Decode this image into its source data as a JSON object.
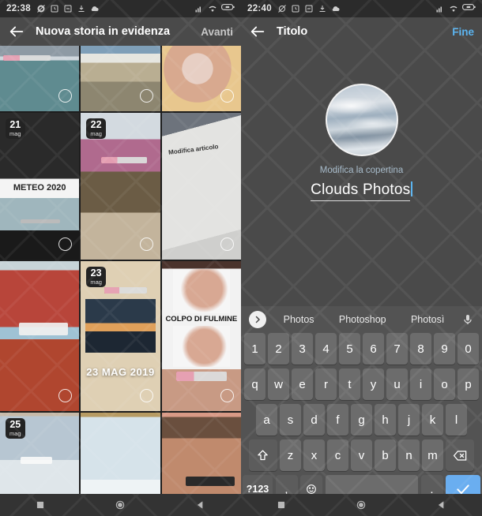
{
  "left_phone": {
    "status_bar": {
      "time": "22:38",
      "icons_left": [
        "alarm-off-icon",
        "clock-icon",
        "screenshot-icon",
        "download-icon",
        "cloud-icon"
      ],
      "icons_right": [
        "signal-icon",
        "wifi-icon",
        "battery-icon"
      ]
    },
    "app_bar": {
      "back": "back-arrow-icon",
      "title": "Nuova storia in evidenza",
      "action": "Avanti"
    },
    "grid": {
      "tiles": [
        {
          "id": "t1",
          "date": null,
          "caption": "",
          "label": ""
        },
        {
          "id": "t2",
          "date": null,
          "caption": "",
          "label": ""
        },
        {
          "id": "t3",
          "date": null,
          "caption": "",
          "label": ""
        },
        {
          "id": "t4",
          "date_day": "21",
          "date_month": "mag",
          "label": "METEO 2020"
        },
        {
          "id": "t5",
          "date_day": "22",
          "date_month": "mag",
          "label": ""
        },
        {
          "id": "t6",
          "date": null,
          "label": "Modifica articolo"
        },
        {
          "id": "t7",
          "date": null,
          "label": ""
        },
        {
          "id": "t8",
          "date_day": "23",
          "date_month": "mag",
          "label": "23 MAG 2019"
        },
        {
          "id": "t9",
          "date": null,
          "label": "COLPO DI FULMINE"
        },
        {
          "id": "t10",
          "date_day": "25",
          "date_month": "mag",
          "label": ""
        },
        {
          "id": "t11",
          "date": null,
          "label": ""
        },
        {
          "id": "t12",
          "date": null,
          "label": ""
        }
      ]
    },
    "nav_bar": {
      "recents": "square-icon",
      "home": "circle-icon",
      "back": "triangle-back-icon"
    }
  },
  "right_phone": {
    "status_bar": {
      "time": "22:40",
      "icons_left": [
        "alarm-off-icon",
        "clock-icon",
        "screenshot-icon",
        "download-icon",
        "cloud-icon"
      ],
      "icons_right": [
        "signal-icon",
        "wifi-icon",
        "battery-icon"
      ]
    },
    "app_bar": {
      "back": "back-arrow-icon",
      "title": "Titolo",
      "action": "Fine"
    },
    "editor": {
      "cover_alt": "clouds-cover-thumbnail",
      "edit_cover_label": "Modifica la copertina",
      "title_value": "Clouds Photos",
      "title_placeholder": "Titolo"
    },
    "keyboard": {
      "suggestions": [
        "Photos",
        "Photoshop",
        "Photosì"
      ],
      "expand_icon": "chevron-right-icon",
      "mic_icon": "microphone-icon",
      "row_numbers": [
        "1",
        "2",
        "3",
        "4",
        "5",
        "6",
        "7",
        "8",
        "9",
        "0"
      ],
      "row_top": [
        "q",
        "w",
        "e",
        "r",
        "t",
        "y",
        "u",
        "i",
        "o",
        "p"
      ],
      "row_home": [
        "a",
        "s",
        "d",
        "f",
        "g",
        "h",
        "j",
        "k",
        "l"
      ],
      "row_bottom": [
        "z",
        "x",
        "c",
        "v",
        "b",
        "n",
        "m"
      ],
      "shift_icon": "shift-up-icon",
      "backspace_icon": "backspace-icon",
      "symbols_key": "?123",
      "comma_key": ",",
      "emoji_key": "emoji-smile-icon",
      "space_key": "",
      "period_key": ".",
      "enter_icon": "checkmark-icon"
    },
    "nav_bar": {
      "recents": "square-icon",
      "home": "circle-icon",
      "back": "triangle-back-icon"
    }
  },
  "colors": {
    "accent_blue": "#5bb4f0",
    "enter_key": "#6aaef0",
    "app_bar": "#4a4a4a",
    "status_bar": "#2b2b2b",
    "keyboard_bg": "#535353",
    "key_bg": "#6c6c6c"
  }
}
